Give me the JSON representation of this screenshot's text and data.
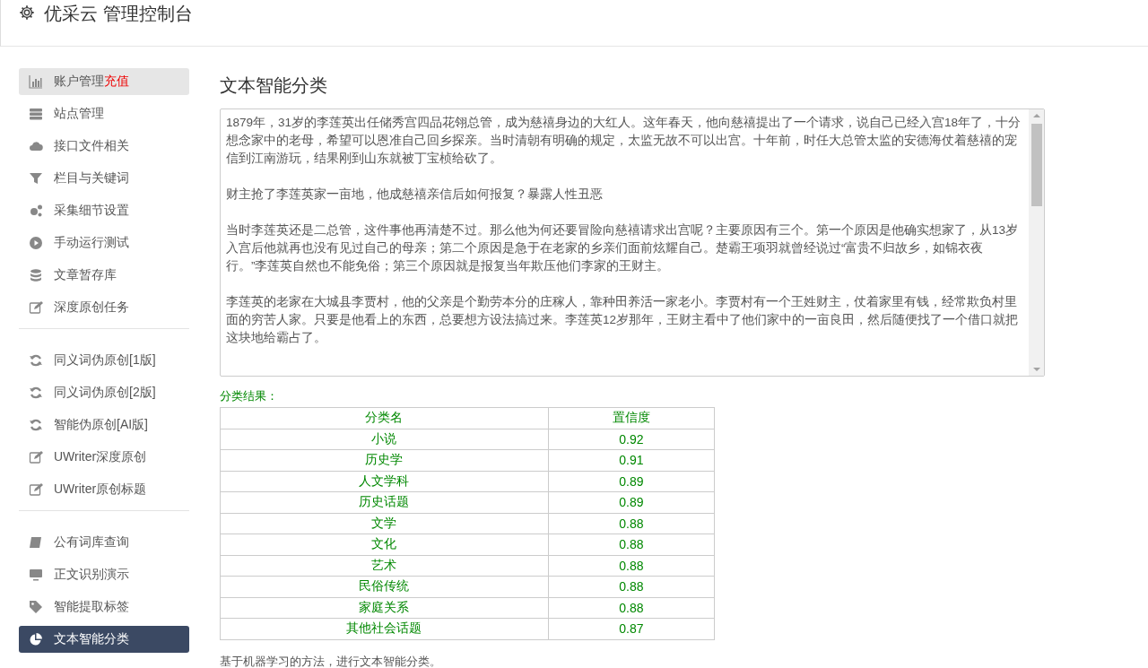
{
  "header": {
    "title": "优采云 管理控制台"
  },
  "sidebar": {
    "groups": [
      {
        "items": [
          {
            "label": "账户管理",
            "badge": "充值",
            "hovered": true,
            "selected": false
          },
          {
            "label": "站点管理",
            "hovered": false,
            "selected": false
          },
          {
            "label": "接口文件相关",
            "hovered": false,
            "selected": false
          },
          {
            "label": "栏目与关键词",
            "hovered": false,
            "selected": false
          },
          {
            "label": "采集细节设置",
            "hovered": false,
            "selected": false
          },
          {
            "label": "手动运行测试",
            "hovered": false,
            "selected": false
          },
          {
            "label": "文章暂存库",
            "hovered": false,
            "selected": false
          },
          {
            "label": "深度原创任务",
            "hovered": false,
            "selected": false
          }
        ]
      },
      {
        "items": [
          {
            "label": "同义词伪原创[1版]",
            "hovered": false,
            "selected": false
          },
          {
            "label": "同义词伪原创[2版]",
            "hovered": false,
            "selected": false
          },
          {
            "label": "智能伪原创[AI版]",
            "hovered": false,
            "selected": false
          },
          {
            "label": "UWriter深度原创",
            "hovered": false,
            "selected": false
          },
          {
            "label": "UWriter原创标题",
            "hovered": false,
            "selected": false
          }
        ]
      },
      {
        "items": [
          {
            "label": "公有词库查询",
            "hovered": false,
            "selected": false
          },
          {
            "label": "正文识别演示",
            "hovered": false,
            "selected": false
          },
          {
            "label": "智能提取标签",
            "hovered": false,
            "selected": false
          },
          {
            "label": "文本智能分类",
            "hovered": false,
            "selected": true
          }
        ]
      }
    ]
  },
  "main": {
    "heading": "文本智能分类",
    "input_text": [
      "1879年，31岁的李莲英出任储秀宫四品花翎总管，成为慈禧身边的大红人。这年春天，他向慈禧提出了一个请求，说自己已经入宫18年了，十分想念家中的老母，希望可以恩准自己回乡探亲。当时清朝有明确的规定，太监无故不可以出宫。十年前，时任大总管太监的安德海仗着慈禧的宠信到江南游玩，结果刚到山东就被丁宝桢给砍了。",
      "财主抢了李莲英家一亩地，他成慈禧亲信后如何报复？暴露人性丑恶",
      "当时李莲英还是二总管，这件事他再清楚不过。那么他为何还要冒险向慈禧请求出宫呢？主要原因有三个。第一个原因是他确实想家了，从13岁入宫后他就再也没有见过自己的母亲；第二个原因是急于在老家的乡亲们面前炫耀自己。楚霸王项羽就曾经说过“富贵不归故乡，如锦衣夜行。”李莲英自然也不能免俗；第三个原因就是报复当年欺压他们李家的王财主。",
      "李莲英的老家在大城县李贾村，他的父亲是个勤劳本分的庄稼人，靠种田养活一家老小。李贾村有一个王姓财主，仗着家里有钱，经常欺负村里面的穷苦人家。只要是他看上的东西，总要想方设法搞过来。李莲英12岁那年，王财主看中了他们家中的一亩良田，然后随便找了一个借口就把这块地给霸占了。"
    ],
    "result_label": "分类结果：",
    "table": {
      "columns": [
        "分类名",
        "置信度"
      ],
      "rows": [
        [
          "小说",
          "0.92"
        ],
        [
          "历史学",
          "0.91"
        ],
        [
          "人文学科",
          "0.89"
        ],
        [
          "历史话题",
          "0.89"
        ],
        [
          "文学",
          "0.88"
        ],
        [
          "文化",
          "0.88"
        ],
        [
          "艺术",
          "0.88"
        ],
        [
          "民俗传统",
          "0.88"
        ],
        [
          "家庭关系",
          "0.88"
        ],
        [
          "其他社会话题",
          "0.87"
        ]
      ]
    },
    "footnote": "基于机器学习的方法，进行文本智能分类。"
  }
}
